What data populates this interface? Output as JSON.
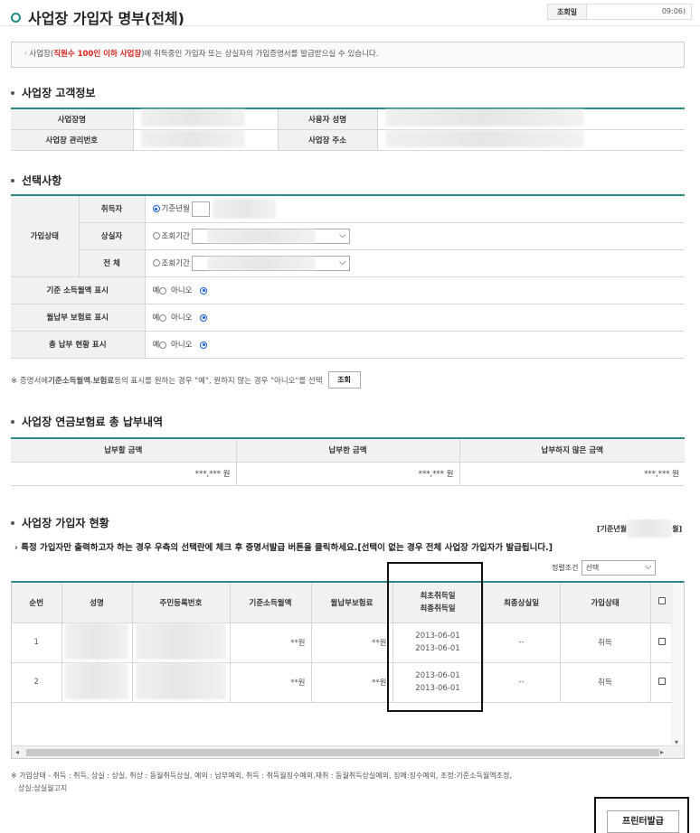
{
  "page": {
    "title": "사업장 가입자 명부(전체)",
    "inquiry_label": "조회일",
    "inquiry_time": "09:06)"
  },
  "notice": {
    "prefix": "사업장(",
    "highlight": "직원수 100인 이하 사업장",
    "suffix": ")에 취득중인 가입자 또는 상실자의 가입증명서를 발급받으실 수 있습니다."
  },
  "customer": {
    "section_title": "사업장 고객정보",
    "labels": {
      "biz_name": "사업장명",
      "owner_name": "사용자 성명",
      "biz_no": "사업장 관리번호",
      "address": "사업장 주소"
    }
  },
  "options": {
    "section_title": "선택사항",
    "status_label": "가입상태",
    "acquired_label": "취득자",
    "acquired_mode": "기준년월",
    "lost_label": "상실자",
    "lost_mode": "조회기간",
    "all_label": "전 체",
    "all_mode": "조회기간",
    "show_income_label": "기준 소득월액 표시",
    "show_premium_label": "월납부 보험료 표시",
    "show_total_label": "총 납부 현황 표시",
    "yes_label": "예",
    "no_label": "아니오",
    "footnote_pre": "※ 증명서에 ",
    "footnote_b1": "기준소득월액",
    "footnote_mid": ", ",
    "footnote_b2": "보험료",
    "footnote_post": " 등의 표시를 원하는 경우 \"예\", 원하지 않는 경우 \"아니오\"를 선택",
    "search_button": "조회"
  },
  "payment": {
    "section_title": "사업장 연금보험료 총 납부내역",
    "headers": [
      "납부할 금액",
      "납부한 금액",
      "납부하지 않은 금액"
    ],
    "values": [
      "***,*** 원",
      "***,*** 원",
      "***,*** 원"
    ]
  },
  "members": {
    "section_title": "사업장 가입자 현황",
    "base_label_start": "[기준년월",
    "base_label_end": "월]",
    "instruction": "특정 가입자만 출력하고자 하는 경우 우측의 선택란에 체크 후 증명서발급 버튼을 클릭하세요.[선택이 없는 경우 전체 사업장 가입자가 발급됩니다.]",
    "sort_label": "정렬조건",
    "sort_value": "선택",
    "headers": {
      "no": "순번",
      "name": "성명",
      "rrn": "주민등록번호",
      "income": "기준소득월액",
      "premium": "월납부보험료",
      "first_acq": "최초취득일",
      "last_acq": "최종취득일",
      "last_loss": "최종상실일",
      "status": "가입상태"
    },
    "rows": [
      {
        "no": "1",
        "income": "**원",
        "premium": "**원",
        "first_acq": "2013-06-01",
        "last_acq": "2013-06-01",
        "last_loss": "--",
        "status": "취득"
      },
      {
        "no": "2",
        "income": "**원",
        "premium": "**원",
        "first_acq": "2013-06-01",
        "last_acq": "2013-06-01",
        "last_loss": "--",
        "status": "취득"
      }
    ]
  },
  "legend": {
    "line1": "※ 가입상태 - 취득 : 취득, 상실 : 상실, 취상 : 동월취득상실, 예외 : 납부예외, 취득 : 취득월징수예외,재취 : 동월취득상실예외, 징예:징수예외, 조정:기준소득월액조정,",
    "line2": "상실:상실월고지"
  },
  "print_button": "프린터발급",
  "colors": {
    "accent": "#2b8a87",
    "notice_red": "#d9231d",
    "radio_blue": "#1a5fd0"
  }
}
